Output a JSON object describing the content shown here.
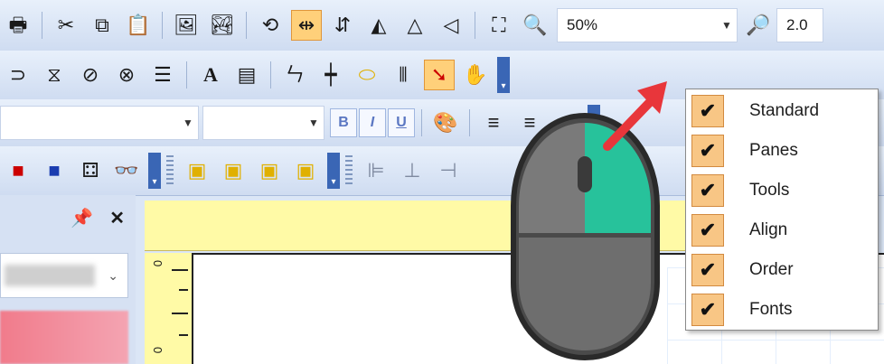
{
  "toolbar": {
    "zoom_value": "50%",
    "zoom_step": "2.0",
    "icons_row1": [
      "printer-icon",
      "cut-icon",
      "copy-icon",
      "paste-icon",
      "image-icon",
      "picture-icon",
      "rotate-icon",
      "flip-horizontal-icon",
      "flip-vertical-icon",
      "mirror-icon",
      "triangle-icon",
      "arrow-left-icon",
      "fit-page-icon",
      "zoom-in-icon"
    ],
    "icons_row2": [
      "ellipse-icon",
      "hourglass-icon",
      "shape-icon",
      "shape2-icon",
      "list-icon",
      "text-icon",
      "textbox-icon",
      "connector-icon",
      "crosshair-icon",
      "tag-icon",
      "bars-icon",
      "pointer-icon",
      "hand-icon"
    ],
    "bold_label": "B",
    "italic_label": "I",
    "underline_label": "U",
    "font_name": "",
    "font_size": ""
  },
  "pane": {
    "pin_icon": "pin-icon",
    "close_icon": "close-icon"
  },
  "ruler": {
    "top_ticks": [],
    "left_numbers": [
      "0",
      "0"
    ]
  },
  "context_menu": {
    "items": [
      {
        "label": "Standard",
        "checked": true
      },
      {
        "label": "Panes",
        "checked": true
      },
      {
        "label": "Tools",
        "checked": true
      },
      {
        "label": "Align",
        "checked": true
      },
      {
        "label": "Order",
        "checked": true
      },
      {
        "label": "Fonts",
        "checked": true
      }
    ]
  },
  "colors": {
    "accent": "#3a66b5",
    "active_button": "#ffd07a",
    "mouse_right_button": "#27c29b",
    "arrow": "#e8363b"
  }
}
